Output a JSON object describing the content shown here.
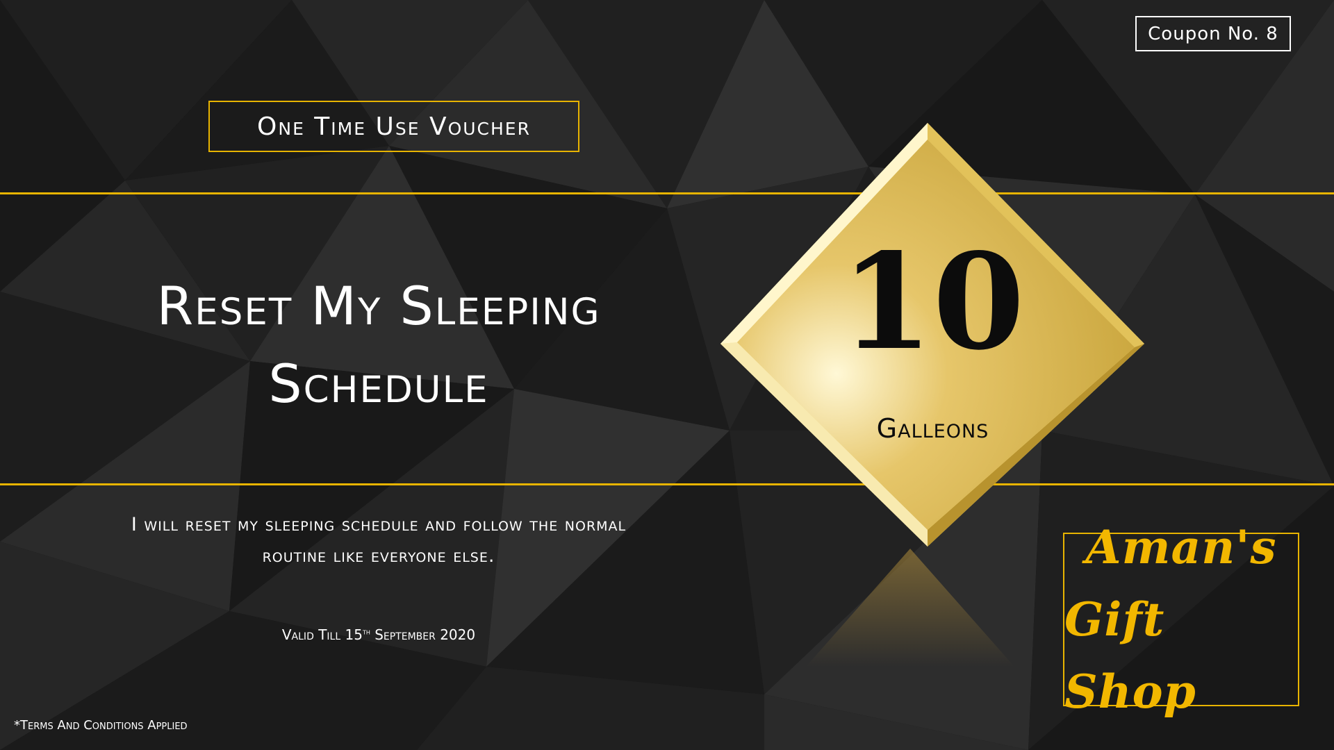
{
  "coupon": {
    "number_label": "Coupon No. 8",
    "badge": "One Time Use Voucher",
    "title_line1": "Reset My Sleeping",
    "title_line2": "Schedule",
    "description_line1": "I will reset my sleeping schedule and follow the normal",
    "description_line2": "routine like everyone else.",
    "validity_prefix": "Valid Till 15",
    "validity_suffix": "th",
    "validity_rest": " September 2020",
    "terms": "*Terms And Conditions Applied"
  },
  "price": {
    "value": "10",
    "currency": "Galleons"
  },
  "shop": {
    "line1": "Aman's",
    "line2": "Gift Shop"
  },
  "colors": {
    "accent_gold": "#e8b400",
    "shop_gold": "#f2b700",
    "background": "#141414"
  }
}
